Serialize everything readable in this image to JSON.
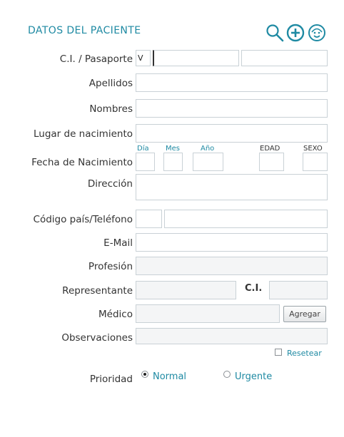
{
  "header": {
    "title": "DATOS DEL PACIENTE",
    "icons": [
      "search-icon",
      "add-circle-icon",
      "patient-face-icon"
    ],
    "accent_color": "#1f8aa3"
  },
  "fields": {
    "ci_pasaporte": {
      "label": "C.I. / Pasaporte",
      "type_value": "V",
      "number_value": "",
      "extra_value": ""
    },
    "apellidos": {
      "label": "Apellidos",
      "value": ""
    },
    "nombres": {
      "label": "Nombres",
      "value": ""
    },
    "lugar_nacimiento": {
      "label": "Lugar de nacimiento",
      "value": ""
    },
    "fecha_nacimiento": {
      "label": "Fecha de Nacimiento",
      "dia_label": "Día",
      "mes_label": "Mes",
      "ano_label": "Año",
      "edad_label": "EDAD",
      "sexo_label": "SEXO",
      "dia": "",
      "mes": "",
      "ano": "",
      "edad": "",
      "sexo": ""
    },
    "direccion": {
      "label": "Dirección",
      "value": ""
    },
    "telefono": {
      "label": "Código país/Teléfono",
      "codigo": "",
      "numero": ""
    },
    "email": {
      "label": "E-Mail",
      "value": ""
    },
    "profesion": {
      "label": "Profesión",
      "value": ""
    },
    "representante": {
      "label": "Representante",
      "value": "",
      "ci_label": "C.I.",
      "ci_value": ""
    },
    "medico": {
      "label": "Médico",
      "value": "",
      "add_button": "Agregar"
    },
    "observaciones": {
      "label": "Observaciones",
      "value": ""
    }
  },
  "reset": {
    "label": "Resetear",
    "checked": false
  },
  "prioridad": {
    "label": "Prioridad",
    "options": [
      "Normal",
      "Urgente"
    ],
    "selected": "Normal"
  }
}
